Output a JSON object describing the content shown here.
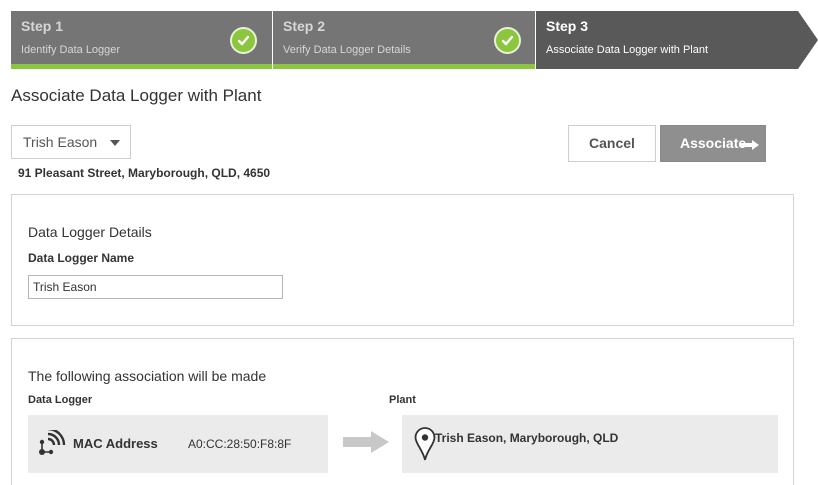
{
  "wizard": {
    "steps": [
      {
        "title": "Step 1",
        "subtitle": "Identify Data Logger",
        "state": "completed"
      },
      {
        "title": "Step 2",
        "subtitle": "Verify Data Logger Details",
        "state": "completed"
      },
      {
        "title": "Step 3",
        "subtitle": "Associate Data Logger with Plant",
        "state": "current"
      }
    ]
  },
  "page": {
    "title": "Associate Data Logger with Plant",
    "owner_select": "Trish Eason",
    "address": "91 Pleasant Street, Maryborough, QLD, 4650"
  },
  "actions": {
    "cancel_label": "Cancel",
    "associate_label": "Associate"
  },
  "details": {
    "title": "Data Logger Details",
    "name_label": "Data Logger Name",
    "name_value": "Trish Eason"
  },
  "association": {
    "title": "The following association will be made",
    "logger_label": "Data Logger",
    "plant_label": "Plant",
    "mac_label": "MAC Address",
    "mac_value": "A0:CC:28:50:F8:8F",
    "plant_value": "Trish Eason, Maryborough, QLD"
  },
  "colors": {
    "complete_green": "#8cc63f",
    "step_done_bg": "#757575",
    "step_current_bg": "#595959",
    "associate_button": "#8f8f8f"
  },
  "icons": {
    "step_complete": "check-circle-icon",
    "owner_dropdown": "chevron-down-icon",
    "associate": "arrow-right-icon",
    "logger": "wifi-signal-icon",
    "flow": "arrow-right-icon",
    "plant": "map-pin-icon"
  }
}
